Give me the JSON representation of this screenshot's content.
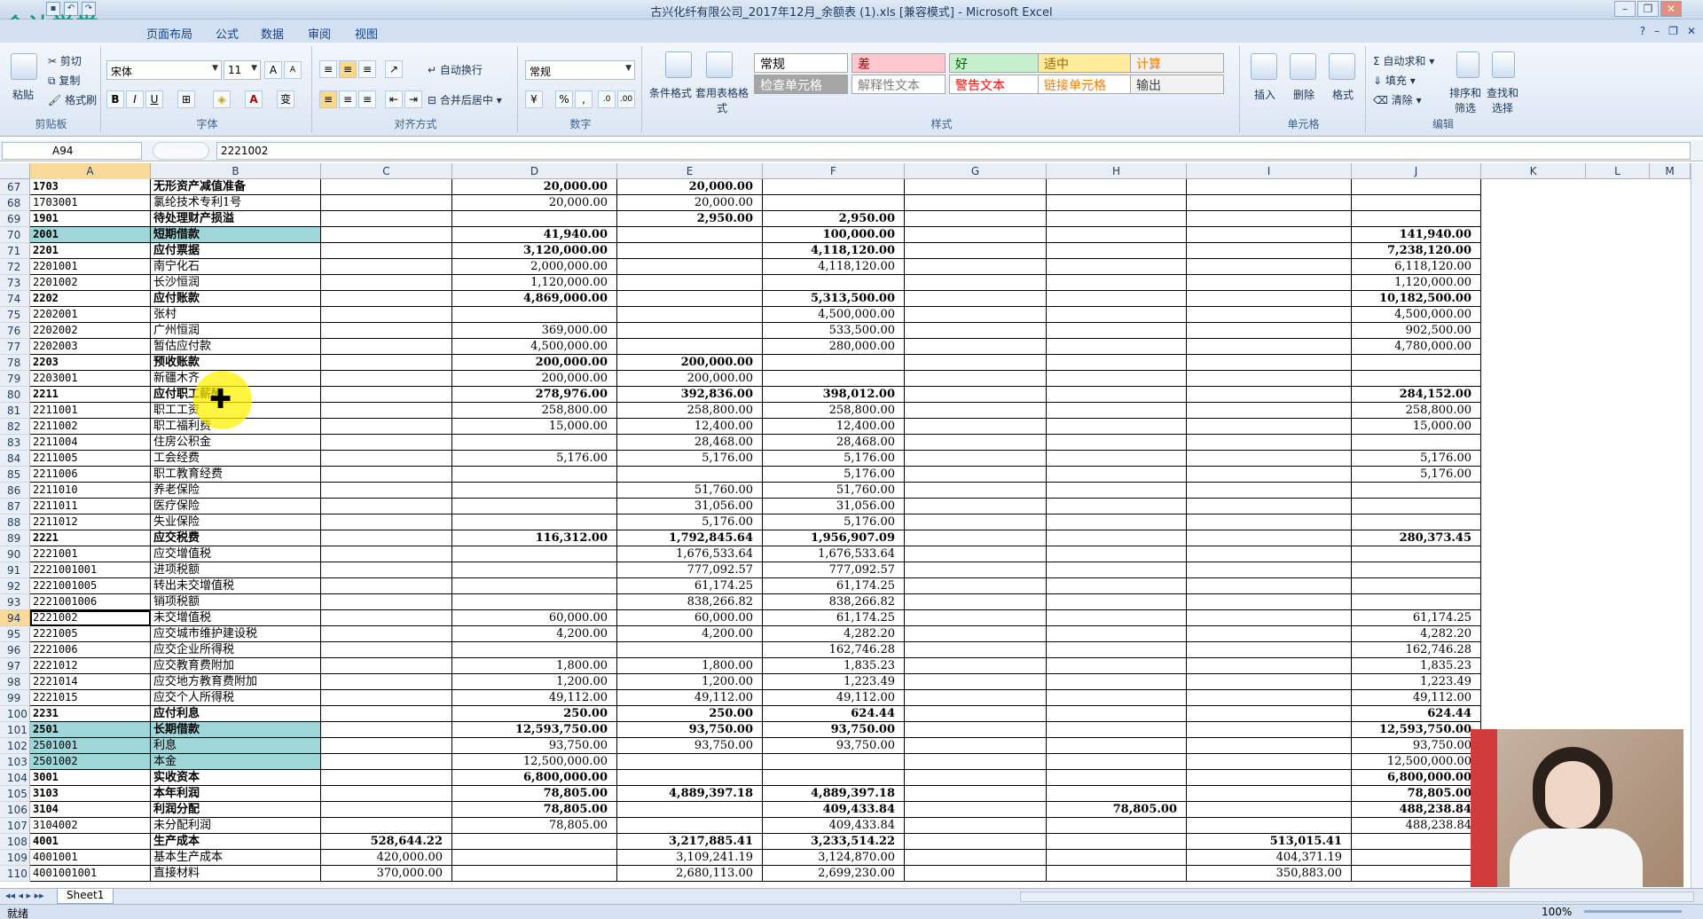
{
  "titlebar": {
    "title": "古兴化纤有限公司_2017年12月_余额表 (1).xls  [兼容模式] - Microsoft Excel",
    "logo": "会计学堂"
  },
  "tabs": [
    "页面布局",
    "公式",
    "数据",
    "审阅",
    "视图"
  ],
  "ribbon": {
    "clipboard": {
      "paste": "粘贴",
      "cut": "剪切",
      "copy": "复制",
      "painter": "格式刷",
      "label": "剪贴板"
    },
    "font": {
      "name": "宋体",
      "size": "11",
      "label": "字体",
      "bold": "B",
      "italic": "I",
      "underline": "U",
      "color_letter": "A",
      "grow": "A",
      "shrink": "A",
      "wen": "变"
    },
    "align": {
      "wrap": "自动换行",
      "merge": "合并后居中",
      "label": "对齐方式"
    },
    "number": {
      "format": "常规",
      "label": "数字",
      "percent": "%",
      "comma": ","
    },
    "styles": {
      "cond": "条件格式",
      "table": "套用表格格式",
      "label": "样式",
      "cells": [
        {
          "text": "常规",
          "bg": "#ffffff",
          "fg": "#000000"
        },
        {
          "text": "差",
          "bg": "#ffc7ce",
          "fg": "#9c0006"
        },
        {
          "text": "好",
          "bg": "#c6efce",
          "fg": "#006100"
        },
        {
          "text": "适中",
          "bg": "#ffeb9c",
          "fg": "#9c6500"
        },
        {
          "text": "计算",
          "bg": "#f2f2f2",
          "fg": "#fa7d00"
        },
        {
          "text": "检查单元格",
          "bg": "#a5a5a5",
          "fg": "#ffffff"
        },
        {
          "text": "解释性文本",
          "bg": "#ffffff",
          "fg": "#7f7f7f"
        },
        {
          "text": "警告文本",
          "bg": "#ffffff",
          "fg": "#ff0000"
        },
        {
          "text": "链接单元格",
          "bg": "#ffffff",
          "fg": "#fa7d00"
        },
        {
          "text": "输出",
          "bg": "#f2f2f2",
          "fg": "#3f3f3f"
        }
      ]
    },
    "cells": {
      "insert": "插入",
      "delete": "删除",
      "format": "格式",
      "label": "单元格"
    },
    "edit": {
      "autosum": "自动求和",
      "fill": "填充",
      "clear": "清除",
      "sort": "排序和筛选",
      "find": "查找和选择",
      "label": "编辑"
    }
  },
  "formula": {
    "name": "A94",
    "value": "2221002"
  },
  "columns": [
    "A",
    "B",
    "C",
    "D",
    "E",
    "F",
    "G",
    "H",
    "I",
    "J",
    "K",
    "L",
    "M"
  ],
  "rows": [
    {
      "n": "67",
      "a": "1703",
      "b": "无形资产减值准备",
      "c": "",
      "d": "20,000.00",
      "e": "20,000.00",
      "f": "",
      "g": "",
      "h": "",
      "i": "",
      "j": "",
      "bold": true
    },
    {
      "n": "68",
      "a": "1703001",
      "b": "氯纶技术专利1号",
      "c": "",
      "d": "20,000.00",
      "e": "20,000.00",
      "f": "",
      "g": "",
      "h": "",
      "i": "",
      "j": ""
    },
    {
      "n": "69",
      "a": "1901",
      "b": "待处理财产损溢",
      "c": "",
      "d": "",
      "e": "2,950.00",
      "f": "2,950.00",
      "g": "",
      "h": "",
      "i": "",
      "j": "",
      "bold": true
    },
    {
      "n": "70",
      "a": "2001",
      "b": "短期借款",
      "c": "",
      "d": "41,940.00",
      "e": "",
      "f": "100,000.00",
      "g": "",
      "h": "",
      "i": "",
      "j": "141,940.00",
      "bold": true,
      "hl": true
    },
    {
      "n": "71",
      "a": "2201",
      "b": "应付票据",
      "c": "",
      "d": "3,120,000.00",
      "e": "",
      "f": "4,118,120.00",
      "g": "",
      "h": "",
      "i": "",
      "j": "7,238,120.00",
      "bold": true
    },
    {
      "n": "72",
      "a": "2201001",
      "b": "南宁化石",
      "c": "",
      "d": "2,000,000.00",
      "e": "",
      "f": "4,118,120.00",
      "g": "",
      "h": "",
      "i": "",
      "j": "6,118,120.00"
    },
    {
      "n": "73",
      "a": "2201002",
      "b": "长沙恒润",
      "c": "",
      "d": "1,120,000.00",
      "e": "",
      "f": "",
      "g": "",
      "h": "",
      "i": "",
      "j": "1,120,000.00"
    },
    {
      "n": "74",
      "a": "2202",
      "b": "应付账款",
      "c": "",
      "d": "4,869,000.00",
      "e": "",
      "f": "5,313,500.00",
      "g": "",
      "h": "",
      "i": "",
      "j": "10,182,500.00",
      "bold": true
    },
    {
      "n": "75",
      "a": "2202001",
      "b": "张村",
      "c": "",
      "d": "",
      "e": "",
      "f": "4,500,000.00",
      "g": "",
      "h": "",
      "i": "",
      "j": "4,500,000.00"
    },
    {
      "n": "76",
      "a": "2202002",
      "b": "广州恒润",
      "c": "",
      "d": "369,000.00",
      "e": "",
      "f": "533,500.00",
      "g": "",
      "h": "",
      "i": "",
      "j": "902,500.00"
    },
    {
      "n": "77",
      "a": "2202003",
      "b": "暂估应付款",
      "c": "",
      "d": "4,500,000.00",
      "e": "",
      "f": "280,000.00",
      "g": "",
      "h": "",
      "i": "",
      "j": "4,780,000.00"
    },
    {
      "n": "78",
      "a": "2203",
      "b": "预收账款",
      "c": "",
      "d": "200,000.00",
      "e": "200,000.00",
      "f": "",
      "g": "",
      "h": "",
      "i": "",
      "j": "",
      "bold": true
    },
    {
      "n": "79",
      "a": "2203001",
      "b": "新疆木齐",
      "c": "",
      "d": "200,000.00",
      "e": "200,000.00",
      "f": "",
      "g": "",
      "h": "",
      "i": "",
      "j": ""
    },
    {
      "n": "80",
      "a": "2211",
      "b": "应付职工薪酬",
      "c": "",
      "d": "278,976.00",
      "e": "392,836.00",
      "f": "398,012.00",
      "g": "",
      "h": "",
      "i": "",
      "j": "284,152.00",
      "bold": true
    },
    {
      "n": "81",
      "a": "2211001",
      "b": "职工工资",
      "c": "",
      "d": "258,800.00",
      "e": "258,800.00",
      "f": "258,800.00",
      "g": "",
      "h": "",
      "i": "",
      "j": "258,800.00"
    },
    {
      "n": "82",
      "a": "2211002",
      "b": "职工福利费",
      "c": "",
      "d": "15,000.00",
      "e": "12,400.00",
      "f": "12,400.00",
      "g": "",
      "h": "",
      "i": "",
      "j": "15,000.00"
    },
    {
      "n": "83",
      "a": "2211004",
      "b": "住房公积金",
      "c": "",
      "d": "",
      "e": "28,468.00",
      "f": "28,468.00",
      "g": "",
      "h": "",
      "i": "",
      "j": ""
    },
    {
      "n": "84",
      "a": "2211005",
      "b": "工会经费",
      "c": "",
      "d": "5,176.00",
      "e": "5,176.00",
      "f": "5,176.00",
      "g": "",
      "h": "",
      "i": "",
      "j": "5,176.00"
    },
    {
      "n": "85",
      "a": "2211006",
      "b": "职工教育经费",
      "c": "",
      "d": "",
      "e": "",
      "f": "5,176.00",
      "g": "",
      "h": "",
      "i": "",
      "j": "5,176.00"
    },
    {
      "n": "86",
      "a": "2211010",
      "b": "养老保险",
      "c": "",
      "d": "",
      "e": "51,760.00",
      "f": "51,760.00",
      "g": "",
      "h": "",
      "i": "",
      "j": ""
    },
    {
      "n": "87",
      "a": "2211011",
      "b": "医疗保险",
      "c": "",
      "d": "",
      "e": "31,056.00",
      "f": "31,056.00",
      "g": "",
      "h": "",
      "i": "",
      "j": ""
    },
    {
      "n": "88",
      "a": "2211012",
      "b": "失业保险",
      "c": "",
      "d": "",
      "e": "5,176.00",
      "f": "5,176.00",
      "g": "",
      "h": "",
      "i": "",
      "j": ""
    },
    {
      "n": "89",
      "a": "2221",
      "b": "应交税费",
      "c": "",
      "d": "116,312.00",
      "e": "1,792,845.64",
      "f": "1,956,907.09",
      "g": "",
      "h": "",
      "i": "",
      "j": "280,373.45",
      "bold": true
    },
    {
      "n": "90",
      "a": "2221001",
      "b": "应交增值税",
      "c": "",
      "d": "",
      "e": "1,676,533.64",
      "f": "1,676,533.64",
      "g": "",
      "h": "",
      "i": "",
      "j": ""
    },
    {
      "n": "91",
      "a": "2221001001",
      "b": "进项税额",
      "c": "",
      "d": "",
      "e": "777,092.57",
      "f": "777,092.57",
      "g": "",
      "h": "",
      "i": "",
      "j": ""
    },
    {
      "n": "92",
      "a": "2221001005",
      "b": "转出未交增值税",
      "c": "",
      "d": "",
      "e": "61,174.25",
      "f": "61,174.25",
      "g": "",
      "h": "",
      "i": "",
      "j": ""
    },
    {
      "n": "93",
      "a": "2221001006",
      "b": "销项税额",
      "c": "",
      "d": "",
      "e": "838,266.82",
      "f": "838,266.82",
      "g": "",
      "h": "",
      "i": "",
      "j": ""
    },
    {
      "n": "94",
      "a": "2221002",
      "b": "未交增值税",
      "c": "",
      "d": "60,000.00",
      "e": "60,000.00",
      "f": "61,174.25",
      "g": "",
      "h": "",
      "i": "",
      "j": "61,174.25",
      "active": true
    },
    {
      "n": "95",
      "a": "2221005",
      "b": "应交城市维护建设税",
      "c": "",
      "d": "4,200.00",
      "e": "4,200.00",
      "f": "4,282.20",
      "g": "",
      "h": "",
      "i": "",
      "j": "4,282.20"
    },
    {
      "n": "96",
      "a": "2221006",
      "b": "应交企业所得税",
      "c": "",
      "d": "",
      "e": "",
      "f": "162,746.28",
      "g": "",
      "h": "",
      "i": "",
      "j": "162,746.28"
    },
    {
      "n": "97",
      "a": "2221012",
      "b": "应交教育费附加",
      "c": "",
      "d": "1,800.00",
      "e": "1,800.00",
      "f": "1,835.23",
      "g": "",
      "h": "",
      "i": "",
      "j": "1,835.23"
    },
    {
      "n": "98",
      "a": "2221014",
      "b": "应交地方教育费附加",
      "c": "",
      "d": "1,200.00",
      "e": "1,200.00",
      "f": "1,223.49",
      "g": "",
      "h": "",
      "i": "",
      "j": "1,223.49"
    },
    {
      "n": "99",
      "a": "2221015",
      "b": "应交个人所得税",
      "c": "",
      "d": "49,112.00",
      "e": "49,112.00",
      "f": "49,112.00",
      "g": "",
      "h": "",
      "i": "",
      "j": "49,112.00"
    },
    {
      "n": "100",
      "a": "2231",
      "b": "应付利息",
      "c": "",
      "d": "250.00",
      "e": "250.00",
      "f": "624.44",
      "g": "",
      "h": "",
      "i": "",
      "j": "624.44",
      "bold": true
    },
    {
      "n": "101",
      "a": "2501",
      "b": "长期借款",
      "c": "",
      "d": "12,593,750.00",
      "e": "93,750.00",
      "f": "93,750.00",
      "g": "",
      "h": "",
      "i": "",
      "j": "12,593,750.00",
      "bold": true,
      "hl": true
    },
    {
      "n": "102",
      "a": "2501001",
      "b": "利息",
      "c": "",
      "d": "93,750.00",
      "e": "93,750.00",
      "f": "93,750.00",
      "g": "",
      "h": "",
      "i": "",
      "j": "93,750.00",
      "hl": true
    },
    {
      "n": "103",
      "a": "2501002",
      "b": "本金",
      "c": "",
      "d": "12,500,000.00",
      "e": "",
      "f": "",
      "g": "",
      "h": "",
      "i": "",
      "j": "12,500,000.00",
      "hl": true
    },
    {
      "n": "104",
      "a": "3001",
      "b": "实收资本",
      "c": "",
      "d": "6,800,000.00",
      "e": "",
      "f": "",
      "g": "",
      "h": "",
      "i": "",
      "j": "6,800,000.00",
      "bold": true
    },
    {
      "n": "105",
      "a": "3103",
      "b": "本年利润",
      "c": "",
      "d": "78,805.00",
      "e": "4,889,397.18",
      "f": "4,889,397.18",
      "g": "",
      "h": "",
      "i": "",
      "j": "78,805.00",
      "bold": true
    },
    {
      "n": "106",
      "a": "3104",
      "b": "利润分配",
      "c": "",
      "d": "78,805.00",
      "e": "",
      "f": "409,433.84",
      "g": "",
      "h": "78,805.00",
      "i": "",
      "j": "488,238.84",
      "bold": true
    },
    {
      "n": "107",
      "a": "3104002",
      "b": "未分配利润",
      "c": "",
      "d": "78,805.00",
      "e": "",
      "f": "409,433.84",
      "g": "",
      "h": "",
      "i": "",
      "j": "488,238.84"
    },
    {
      "n": "108",
      "a": "4001",
      "b": "生产成本",
      "c": "528,644.22",
      "d": "",
      "e": "3,217,885.41",
      "f": "3,233,514.22",
      "g": "",
      "h": "",
      "i": "513,015.41",
      "j": "",
      "bold": true
    },
    {
      "n": "109",
      "a": "4001001",
      "b": "基本生产成本",
      "c": "420,000.00",
      "d": "",
      "e": "3,109,241.19",
      "f": "3,124,870.00",
      "g": "",
      "h": "",
      "i": "404,371.19",
      "j": ""
    },
    {
      "n": "110",
      "a": "4001001001",
      "b": "直接材料",
      "c": "370,000.00",
      "d": "",
      "e": "2,680,113.00",
      "f": "2,699,230.00",
      "g": "",
      "h": "",
      "i": "350,883.00",
      "j": ""
    }
  ],
  "sheet": {
    "tab": "Sheet1"
  },
  "status": {
    "ready": "就绪",
    "zoom": "100%"
  }
}
